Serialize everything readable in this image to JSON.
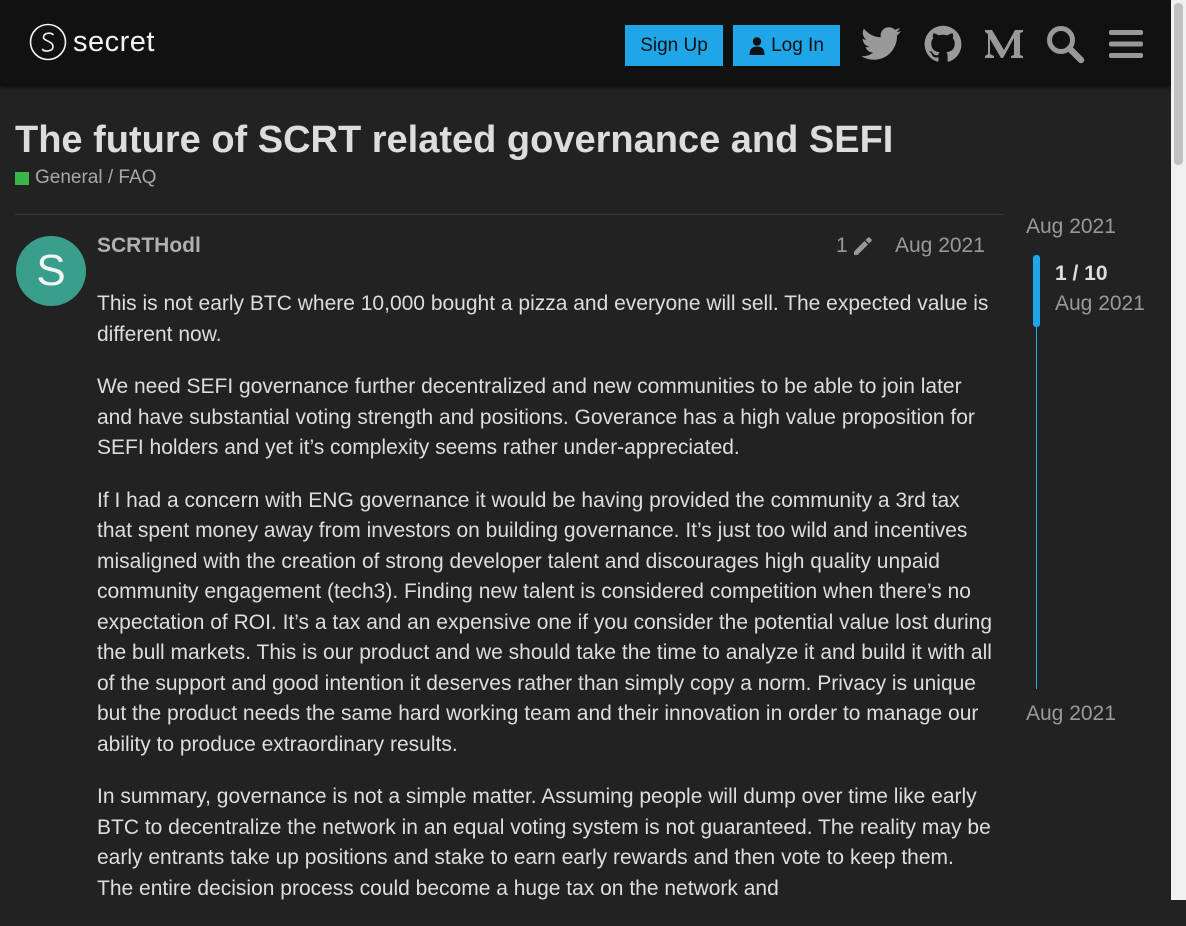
{
  "header": {
    "logo_text": "secret",
    "signup_label": "Sign Up",
    "login_label": "Log In",
    "icons": [
      "twitter-icon",
      "github-icon",
      "medium-icon",
      "search-icon",
      "hamburger-menu-icon"
    ]
  },
  "topic": {
    "title": "The future of SCRT related governance and SEFI",
    "category": "General / FAQ",
    "category_color": "#3ab54a"
  },
  "post": {
    "avatar_letter": "S",
    "avatar_color": "#3a9e8c",
    "username": "SCRTHodl",
    "edit_count": "1",
    "date": "Aug 2021",
    "paragraphs": [
      "This is not early BTC where 10,000 bought a pizza and everyone will sell. The expected value is different now.",
      "We need SEFI governance further decentralized and new communities to be able to join later and have substantial voting strength and positions. Goverance has a high value proposition for SEFI holders and yet it’s complexity seems rather under-appreciated.",
      "If I had a concern with ENG governance it would be having provided the community a 3rd tax that spent money away from investors on building governance. It’s just too wild and incentives misaligned with the creation of strong developer talent and discourages high quality unpaid community engagement (tech3). Finding new talent is considered competition when there’s no expectation of ROI. It’s a tax and an expensive one if you consider the potential value lost during the bull markets. This is our product and we should take the time to analyze it and build it with all of the support and good intention it deserves rather than simply copy a norm. Privacy is unique but the product needs the same hard working team and their innovation in order to manage our ability to produce extraordinary results.",
      "In summary, governance is not a simple matter. Assuming people will dump over time like early BTC to decentralize the network in an equal voting system is not guaranteed. The reality may be early entrants take up positions and stake to earn early rewards and then vote to keep them. The entire decision process could become a huge tax on the network and"
    ]
  },
  "timeline": {
    "start_date": "Aug 2021",
    "position": "1 / 10",
    "position_date": "Aug 2021",
    "end_date": "Aug 2021"
  },
  "colors": {
    "accent": "#1fa6e8",
    "background": "#222222",
    "header_bg": "#111111"
  }
}
